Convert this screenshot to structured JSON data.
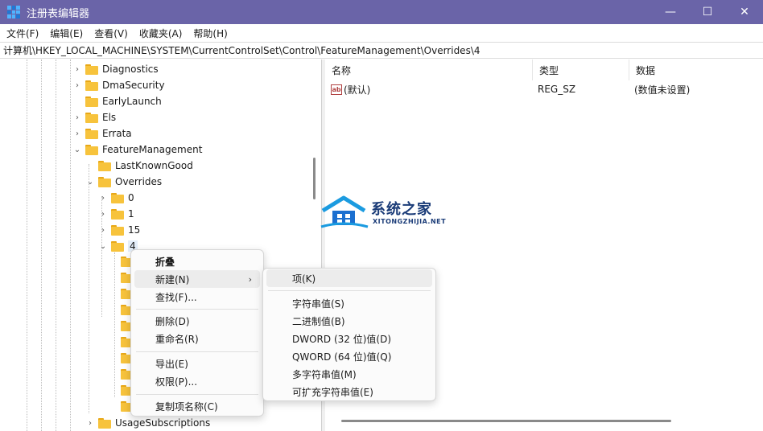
{
  "window": {
    "title": "注册表编辑器",
    "minimize_glyph": "—",
    "maximize_glyph": "☐",
    "close_glyph": "✕",
    "accent": "#6a64a8"
  },
  "menubar": {
    "items": [
      {
        "label": "文件(F)"
      },
      {
        "label": "编辑(E)"
      },
      {
        "label": "查看(V)"
      },
      {
        "label": "收藏夹(A)"
      },
      {
        "label": "帮助(H)"
      }
    ]
  },
  "address": {
    "path": "计算机\\HKEY_LOCAL_MACHINE\\SYSTEM\\CurrentControlSet\\Control\\FeatureManagement\\Overrides\\4"
  },
  "tree": {
    "items": [
      {
        "label": "Diagnostics",
        "expander": "›"
      },
      {
        "label": "DmaSecurity",
        "expander": "›"
      },
      {
        "label": "EarlyLaunch",
        "expander": ""
      },
      {
        "label": "Els",
        "expander": "›"
      },
      {
        "label": "Errata",
        "expander": "›"
      },
      {
        "label": "FeatureManagement",
        "expander": "⌄"
      },
      {
        "label": "LastKnownGood",
        "expander": ""
      },
      {
        "label": "Overrides",
        "expander": "⌄"
      },
      {
        "label": "0",
        "expander": "›"
      },
      {
        "label": "1",
        "expander": "›"
      },
      {
        "label": "15",
        "expander": "›"
      },
      {
        "label": "4",
        "expander": "⌄"
      },
      {
        "label": "UsageSubscriptions",
        "expander": "›"
      }
    ]
  },
  "list": {
    "columns": [
      {
        "label": "名称"
      },
      {
        "label": "类型"
      },
      {
        "label": "数据"
      }
    ],
    "rows": [
      {
        "icon": "ab",
        "name": "(默认)",
        "type": "REG_SZ",
        "data": "(数值未设置)"
      }
    ]
  },
  "context_menu": {
    "collapse": "折叠",
    "new": "新建(N)",
    "new_arrow": "›",
    "find": "查找(F)...",
    "delete": "删除(D)",
    "rename": "重命名(R)",
    "export": "导出(E)",
    "permissions": "权限(P)...",
    "copy_key_name": "复制项名称(C)"
  },
  "submenu": {
    "key": "项(K)",
    "string_value": "字符串值(S)",
    "binary_value": "二进制值(B)",
    "dword_value": "DWORD (32 位)值(D)",
    "qword_value": "QWORD (64 位)值(Q)",
    "multi_string_value": "多字符串值(M)",
    "expandable_string_value": "可扩充字符串值(E)"
  },
  "watermark": {
    "brand": "系统之家",
    "domain": "XITONGZHIJIA.NET"
  }
}
